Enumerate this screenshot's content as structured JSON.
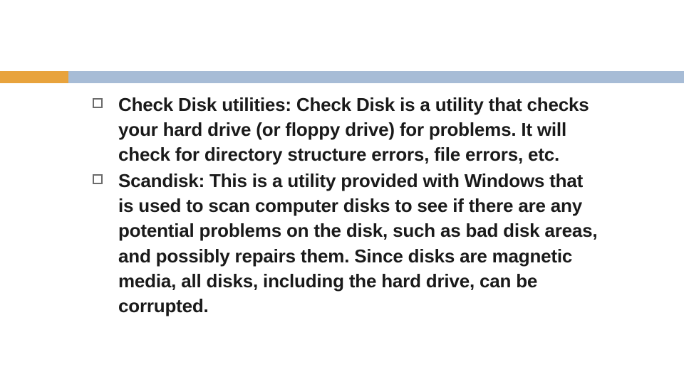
{
  "slide": {
    "accentColor": "#e8a33d",
    "ruleColor": "#a7bcd6",
    "bullets": [
      {
        "text": "Check Disk utilities: Check Disk is a utility that checks your hard drive (or floppy drive) for problems. It will check for directory structure errors, file errors, etc."
      },
      {
        "text": "Scandisk: This is a utility provided with Windows that is used to scan computer disks to see if there are any potential problems on the disk, such as bad disk areas, and possibly repairs them. Since disks are magnetic media, all disks, including the hard drive, can be corrupted."
      }
    ]
  }
}
